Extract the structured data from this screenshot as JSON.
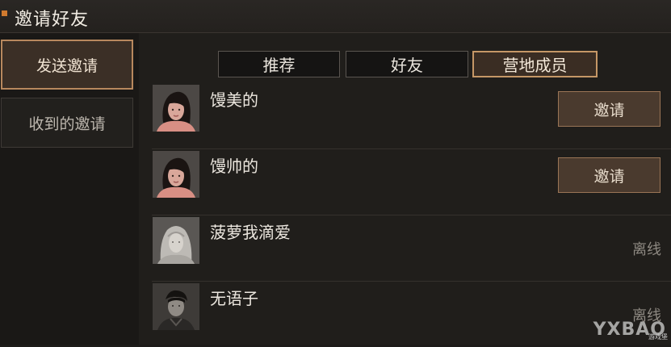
{
  "header": {
    "title": "邀请好友",
    "accent_color": "#d07a2e"
  },
  "sidebar": {
    "items": [
      {
        "label": "发送邀请",
        "active": true
      },
      {
        "label": "收到的邀请",
        "active": false
      }
    ]
  },
  "tabs": [
    {
      "label": "推荐",
      "active": false
    },
    {
      "label": "好友",
      "active": false
    },
    {
      "label": "营地成员",
      "active": true
    }
  ],
  "members": [
    {
      "name": "馒美的",
      "action": "邀请",
      "avatar": "female-avatar"
    },
    {
      "name": "馒帅的",
      "action": "邀请",
      "avatar": "female-avatar"
    },
    {
      "name": "菠萝我滴爱",
      "status": "离线",
      "avatar": "hooded-avatar"
    },
    {
      "name": "无语子",
      "status": "离线",
      "avatar": "male-avatar"
    }
  ],
  "watermark": {
    "text": "YXBAO",
    "sub": "游戏堡"
  }
}
